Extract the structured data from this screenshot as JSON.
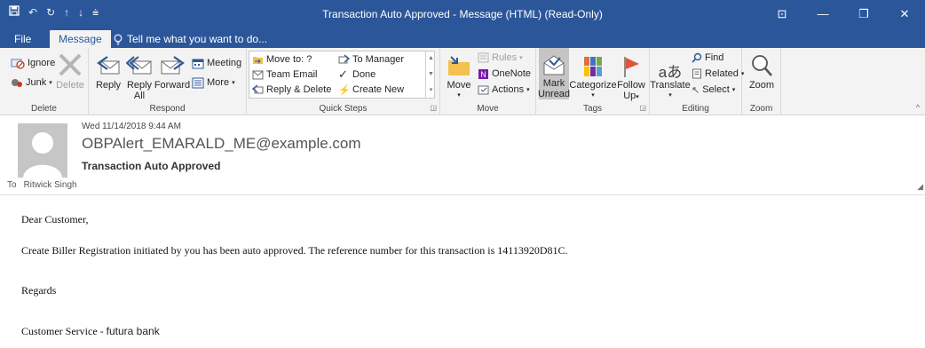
{
  "window": {
    "title": "Transaction Auto Approved - Message (HTML) (Read-Only)"
  },
  "tabs": {
    "file": "File",
    "message": "Message",
    "tell_me": "Tell me what you want to do..."
  },
  "ribbon": {
    "delete_group": {
      "label": "Delete",
      "ignore": "Ignore",
      "junk": "Junk",
      "delete": "Delete"
    },
    "respond_group": {
      "label": "Respond",
      "reply": "Reply",
      "reply_all_1": "Reply",
      "reply_all_2": "All",
      "forward": "Forward",
      "meeting": "Meeting",
      "more": "More"
    },
    "quick_steps_group": {
      "label": "Quick Steps",
      "items": [
        "Move to: ?",
        "Team Email",
        "Reply & Delete",
        "To Manager",
        "Done",
        "Create New"
      ]
    },
    "move_group": {
      "label": "Move",
      "move": "Move",
      "rules": "Rules",
      "onenote": "OneNote",
      "actions": "Actions"
    },
    "tags_group": {
      "label": "Tags",
      "mark_unread_1": "Mark",
      "mark_unread_2": "Unread",
      "categorize": "Categorize",
      "follow_up_1": "Follow",
      "follow_up_2": "Up"
    },
    "editing_group": {
      "label": "Editing",
      "translate": "Translate",
      "find": "Find",
      "related": "Related",
      "select": "Select"
    },
    "zoom_group": {
      "label": "Zoom",
      "zoom": "Zoom"
    }
  },
  "message": {
    "date": "Wed 11/14/2018 9:44 AM",
    "sender": "OBPAlert_EMARALD_ME@example.com",
    "subject": "Transaction Auto Approved",
    "to_label": "To",
    "to_name": "Ritwick Singh"
  },
  "body": {
    "greeting": "Dear Customer,",
    "paragraph": "Create Biller Registration initiated by you has been auto approved. The reference number for this transaction is 14113920D81C.",
    "regards": "Regards",
    "signature_prefix": "Customer Service - ",
    "signature_bank": "futura bank"
  },
  "colors": {
    "title_bar": "#2b579a",
    "ribbon_bg": "#f3f3f3",
    "follow_up_flag": "#e0553a"
  }
}
